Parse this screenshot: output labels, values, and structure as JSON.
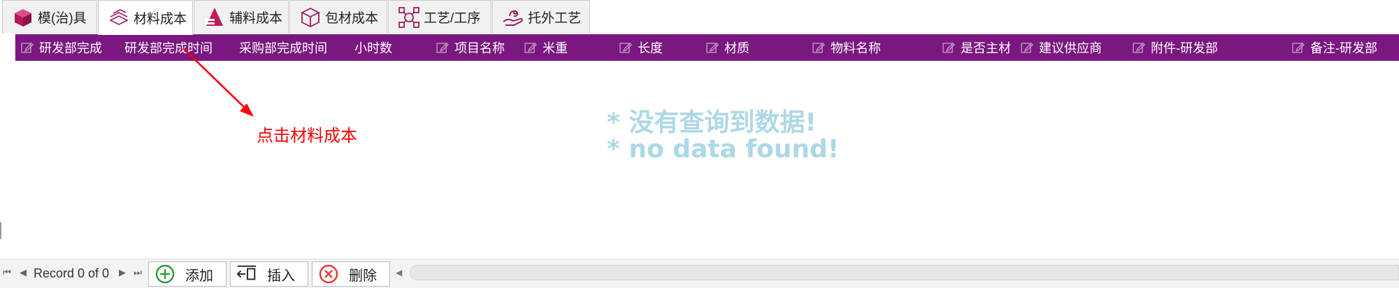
{
  "tabs": [
    {
      "label": "模(治)具",
      "icon": "cube-icon"
    },
    {
      "label": "材料成本",
      "icon": "material-stack-icon"
    },
    {
      "label": "辅料成本",
      "icon": "triangle-layers-icon"
    },
    {
      "label": "包材成本",
      "icon": "box-icon"
    },
    {
      "label": "工艺/工序",
      "icon": "process-icon"
    },
    {
      "label": "托外工艺",
      "icon": "hand-icon"
    }
  ],
  "columns": [
    {
      "label": "研发部完成",
      "editable": true
    },
    {
      "label": "研发部完成时间",
      "editable": false
    },
    {
      "label": "采购部完成时间",
      "editable": false
    },
    {
      "label": "小时数",
      "editable": false
    },
    {
      "label": "项目名称",
      "editable": true
    },
    {
      "label": "米重",
      "editable": true
    },
    {
      "label": "长度",
      "editable": true
    },
    {
      "label": "材质",
      "editable": true
    },
    {
      "label": "物料名称",
      "editable": true
    },
    {
      "label": "是否主材",
      "editable": true
    },
    {
      "label": "建议供应商",
      "editable": true
    },
    {
      "label": "附件-研发部",
      "editable": true
    },
    {
      "label": "备注-研发部",
      "editable": true
    }
  ],
  "empty_message": {
    "line1": "* 没有查询到数据!",
    "line2": "* no data found!"
  },
  "annotation": {
    "text": "点击材料成本",
    "color": "#ff0000"
  },
  "navigator": {
    "record_text": "Record 0 of 0",
    "add_label": "添加",
    "insert_label": "插入",
    "delete_label": "删除"
  },
  "colors": {
    "header_bg": "#7b1780",
    "tab_icon": "#c2185b",
    "empty_text": "#add8e6"
  }
}
